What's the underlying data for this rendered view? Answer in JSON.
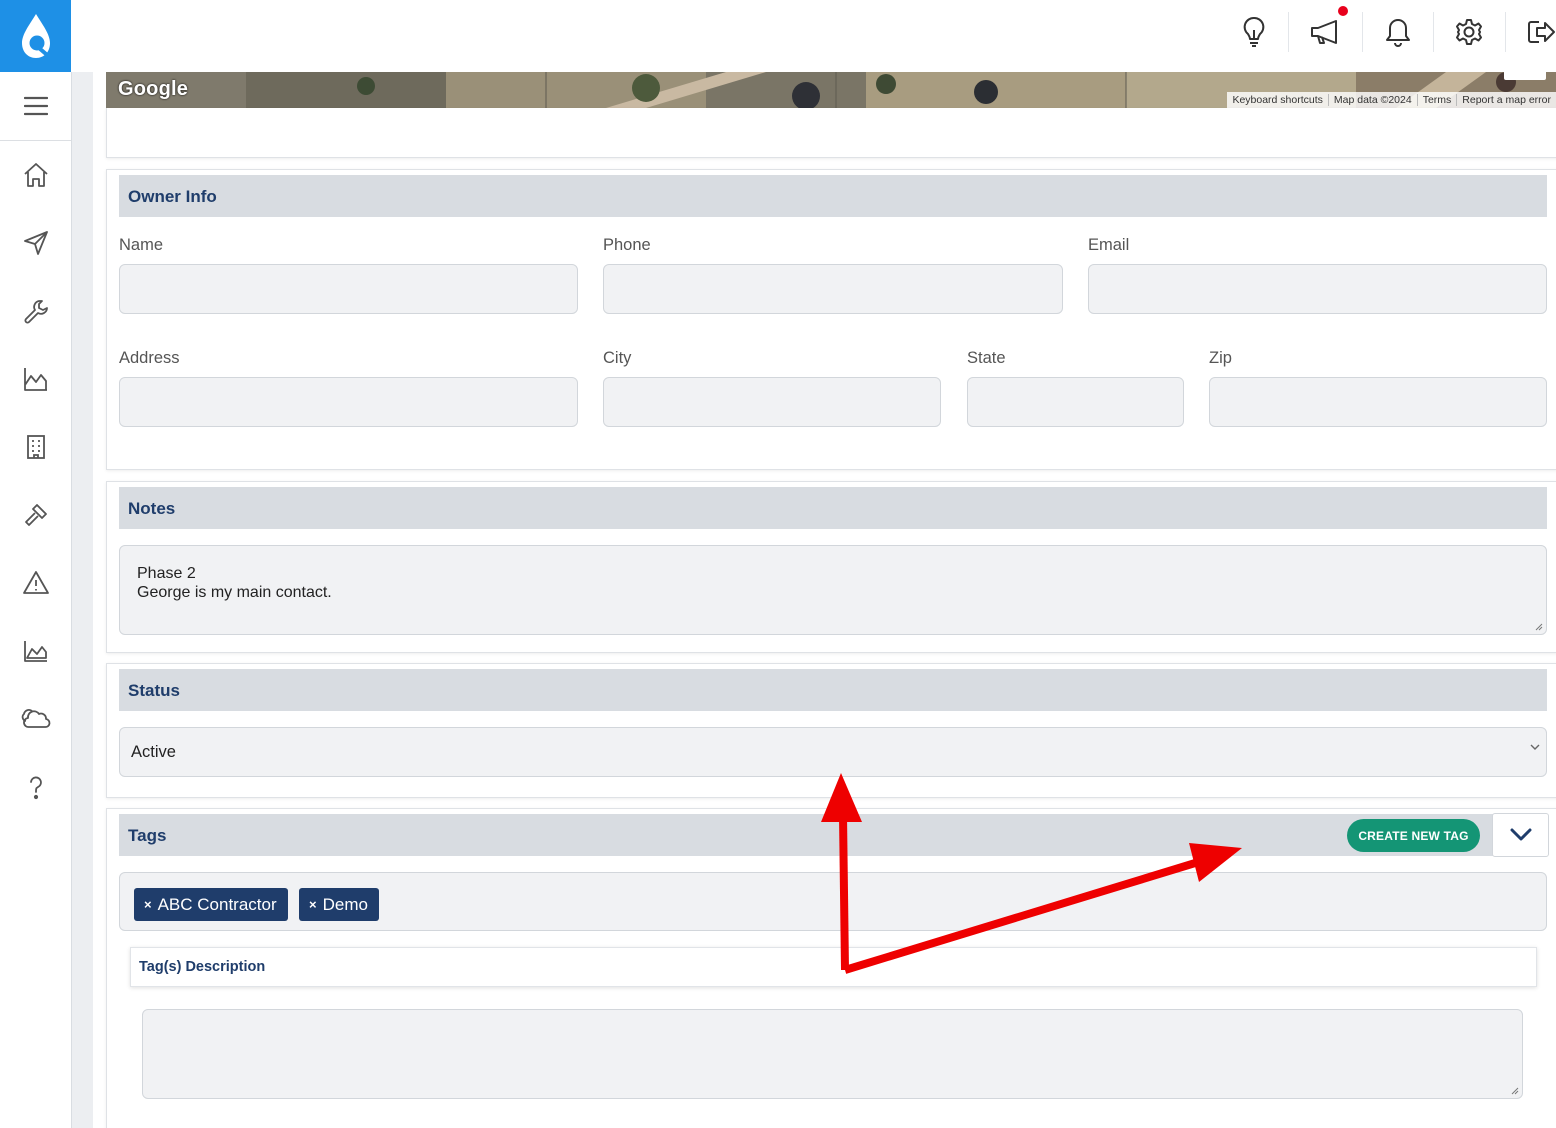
{
  "app": {
    "brand_color": "#1e90e6",
    "logo_icon": "water-drop-logo-icon"
  },
  "topbar": {
    "icons": [
      "lightbulb-icon",
      "megaphone-icon",
      "bell-icon",
      "gear-icon",
      "logout-icon"
    ],
    "notification_dot_color": "#e8001c"
  },
  "sidebar": {
    "items": [
      "menu-icon",
      "home-icon",
      "navigation-icon",
      "wrench-icon",
      "chart-icon",
      "building-icon",
      "hammer-icon",
      "warning-icon",
      "area-chart-icon",
      "cloud-icon",
      "help-icon"
    ]
  },
  "map": {
    "logo": "Google",
    "attribution": [
      "Keyboard shortcuts",
      "Map data ©2024",
      "Terms",
      "Report a map error"
    ]
  },
  "owner_info": {
    "title": "Owner Info",
    "name_label": "Name",
    "name_value": "",
    "phone_label": "Phone",
    "phone_value": "",
    "email_label": "Email",
    "email_value": "",
    "address_label": "Address",
    "address_value": "",
    "city_label": "City",
    "city_value": "",
    "state_label": "State",
    "state_value": "",
    "zip_label": "Zip",
    "zip_value": ""
  },
  "notes": {
    "title": "Notes",
    "line1": "Phase 2",
    "line2": "George is my main contact."
  },
  "status": {
    "title": "Status",
    "selected": "Active"
  },
  "tags": {
    "title": "Tags",
    "create_label": "CREATE NEW TAG",
    "chips": [
      "ABC Contractor",
      "Demo"
    ],
    "chip_remove_glyph": "×",
    "description_title": "Tag(s) Description",
    "description_value": ""
  },
  "annotation": {
    "arrow_color": "#ee0000"
  }
}
